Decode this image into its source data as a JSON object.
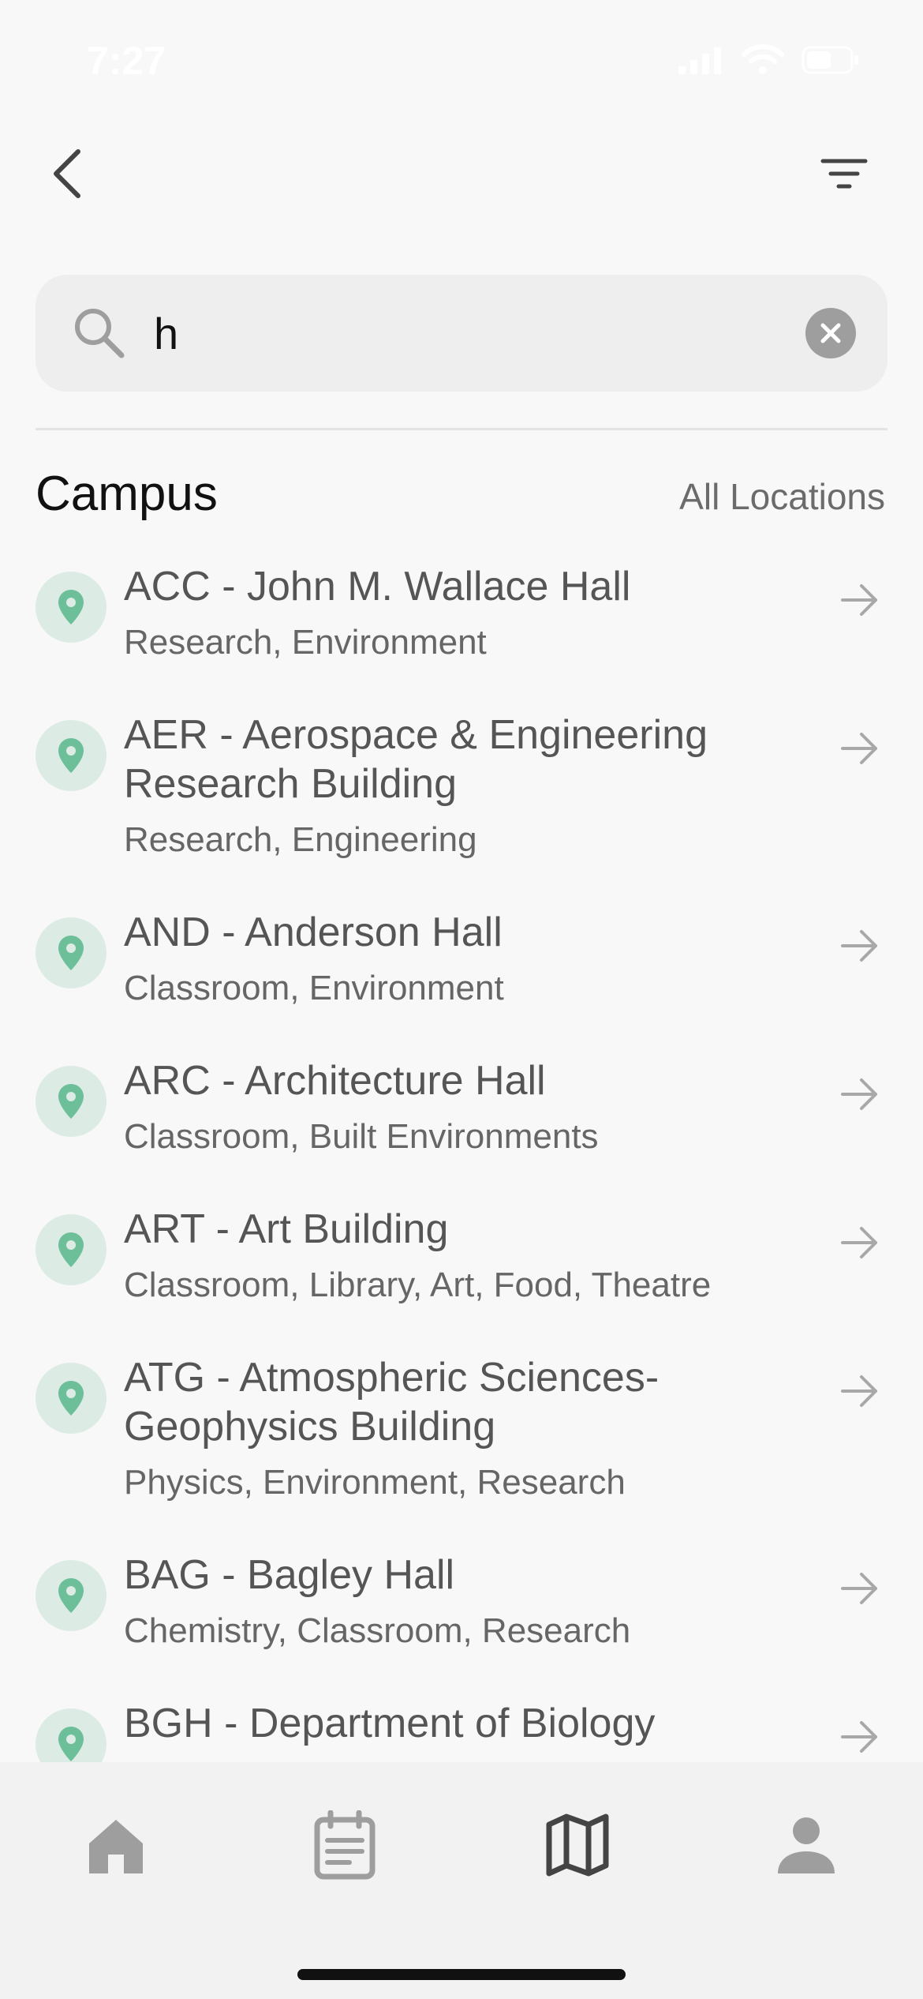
{
  "status_bar": {
    "time": "7:27"
  },
  "search": {
    "value": "h",
    "placeholder": ""
  },
  "section": {
    "title": "Campus",
    "all_locations_label": "All Locations"
  },
  "results": [
    {
      "title": "ACC - John M. Wallace Hall",
      "tags": "Research, Environment"
    },
    {
      "title": "AER - Aerospace & Engineering Research Building",
      "tags": "Research, Engineering"
    },
    {
      "title": "AND - Anderson Hall",
      "tags": "Classroom, Environment"
    },
    {
      "title": "ARC - Architecture Hall",
      "tags": "Classroom, Built Environments"
    },
    {
      "title": "ART - Art Building",
      "tags": "Classroom, Library, Art, Food, Theatre"
    },
    {
      "title": "ATG - Atmospheric Sciences-Geophysics Building",
      "tags": "Physics, Environment, Research"
    },
    {
      "title": "BAG - Bagley Hall",
      "tags": "Chemistry, Classroom, Research"
    },
    {
      "title": "BGH - Department of Biology",
      "tags": ""
    }
  ],
  "colors": {
    "accent_green": "#6dbf99",
    "pin_bg": "#dcebe4",
    "icon_gray": "#9e9e9e",
    "active_nav": "#444444"
  },
  "icons": {
    "back": "chevron-left-icon",
    "filter": "filter-icon",
    "search": "search-icon",
    "clear": "clear-icon",
    "pin": "map-pin-icon",
    "arrow": "arrow-right-icon",
    "nav": [
      "home-icon",
      "calendar-icon",
      "map-icon",
      "profile-icon"
    ]
  }
}
